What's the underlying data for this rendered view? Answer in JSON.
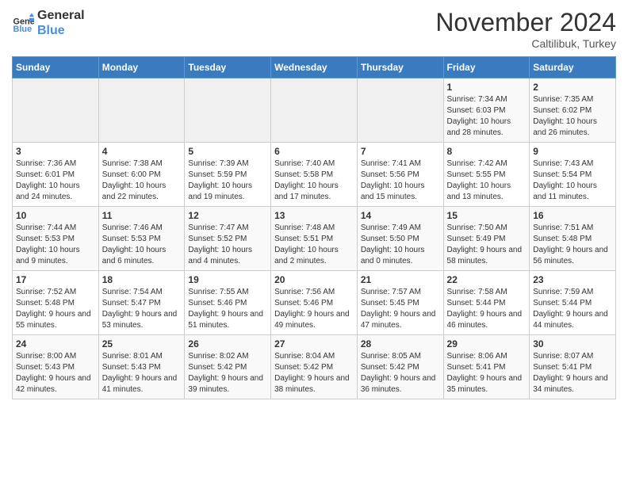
{
  "header": {
    "logo_line1": "General",
    "logo_line2": "Blue",
    "month": "November 2024",
    "location": "Caltilibuk, Turkey"
  },
  "days_of_week": [
    "Sunday",
    "Monday",
    "Tuesday",
    "Wednesday",
    "Thursday",
    "Friday",
    "Saturday"
  ],
  "weeks": [
    [
      {
        "day": "",
        "info": ""
      },
      {
        "day": "",
        "info": ""
      },
      {
        "day": "",
        "info": ""
      },
      {
        "day": "",
        "info": ""
      },
      {
        "day": "",
        "info": ""
      },
      {
        "day": "1",
        "info": "Sunrise: 7:34 AM\nSunset: 6:03 PM\nDaylight: 10 hours and 28 minutes."
      },
      {
        "day": "2",
        "info": "Sunrise: 7:35 AM\nSunset: 6:02 PM\nDaylight: 10 hours and 26 minutes."
      }
    ],
    [
      {
        "day": "3",
        "info": "Sunrise: 7:36 AM\nSunset: 6:01 PM\nDaylight: 10 hours and 24 minutes."
      },
      {
        "day": "4",
        "info": "Sunrise: 7:38 AM\nSunset: 6:00 PM\nDaylight: 10 hours and 22 minutes."
      },
      {
        "day": "5",
        "info": "Sunrise: 7:39 AM\nSunset: 5:59 PM\nDaylight: 10 hours and 19 minutes."
      },
      {
        "day": "6",
        "info": "Sunrise: 7:40 AM\nSunset: 5:58 PM\nDaylight: 10 hours and 17 minutes."
      },
      {
        "day": "7",
        "info": "Sunrise: 7:41 AM\nSunset: 5:56 PM\nDaylight: 10 hours and 15 minutes."
      },
      {
        "day": "8",
        "info": "Sunrise: 7:42 AM\nSunset: 5:55 PM\nDaylight: 10 hours and 13 minutes."
      },
      {
        "day": "9",
        "info": "Sunrise: 7:43 AM\nSunset: 5:54 PM\nDaylight: 10 hours and 11 minutes."
      }
    ],
    [
      {
        "day": "10",
        "info": "Sunrise: 7:44 AM\nSunset: 5:53 PM\nDaylight: 10 hours and 9 minutes."
      },
      {
        "day": "11",
        "info": "Sunrise: 7:46 AM\nSunset: 5:53 PM\nDaylight: 10 hours and 6 minutes."
      },
      {
        "day": "12",
        "info": "Sunrise: 7:47 AM\nSunset: 5:52 PM\nDaylight: 10 hours and 4 minutes."
      },
      {
        "day": "13",
        "info": "Sunrise: 7:48 AM\nSunset: 5:51 PM\nDaylight: 10 hours and 2 minutes."
      },
      {
        "day": "14",
        "info": "Sunrise: 7:49 AM\nSunset: 5:50 PM\nDaylight: 10 hours and 0 minutes."
      },
      {
        "day": "15",
        "info": "Sunrise: 7:50 AM\nSunset: 5:49 PM\nDaylight: 9 hours and 58 minutes."
      },
      {
        "day": "16",
        "info": "Sunrise: 7:51 AM\nSunset: 5:48 PM\nDaylight: 9 hours and 56 minutes."
      }
    ],
    [
      {
        "day": "17",
        "info": "Sunrise: 7:52 AM\nSunset: 5:48 PM\nDaylight: 9 hours and 55 minutes."
      },
      {
        "day": "18",
        "info": "Sunrise: 7:54 AM\nSunset: 5:47 PM\nDaylight: 9 hours and 53 minutes."
      },
      {
        "day": "19",
        "info": "Sunrise: 7:55 AM\nSunset: 5:46 PM\nDaylight: 9 hours and 51 minutes."
      },
      {
        "day": "20",
        "info": "Sunrise: 7:56 AM\nSunset: 5:46 PM\nDaylight: 9 hours and 49 minutes."
      },
      {
        "day": "21",
        "info": "Sunrise: 7:57 AM\nSunset: 5:45 PM\nDaylight: 9 hours and 47 minutes."
      },
      {
        "day": "22",
        "info": "Sunrise: 7:58 AM\nSunset: 5:44 PM\nDaylight: 9 hours and 46 minutes."
      },
      {
        "day": "23",
        "info": "Sunrise: 7:59 AM\nSunset: 5:44 PM\nDaylight: 9 hours and 44 minutes."
      }
    ],
    [
      {
        "day": "24",
        "info": "Sunrise: 8:00 AM\nSunset: 5:43 PM\nDaylight: 9 hours and 42 minutes."
      },
      {
        "day": "25",
        "info": "Sunrise: 8:01 AM\nSunset: 5:43 PM\nDaylight: 9 hours and 41 minutes."
      },
      {
        "day": "26",
        "info": "Sunrise: 8:02 AM\nSunset: 5:42 PM\nDaylight: 9 hours and 39 minutes."
      },
      {
        "day": "27",
        "info": "Sunrise: 8:04 AM\nSunset: 5:42 PM\nDaylight: 9 hours and 38 minutes."
      },
      {
        "day": "28",
        "info": "Sunrise: 8:05 AM\nSunset: 5:42 PM\nDaylight: 9 hours and 36 minutes."
      },
      {
        "day": "29",
        "info": "Sunrise: 8:06 AM\nSunset: 5:41 PM\nDaylight: 9 hours and 35 minutes."
      },
      {
        "day": "30",
        "info": "Sunrise: 8:07 AM\nSunset: 5:41 PM\nDaylight: 9 hours and 34 minutes."
      }
    ]
  ]
}
